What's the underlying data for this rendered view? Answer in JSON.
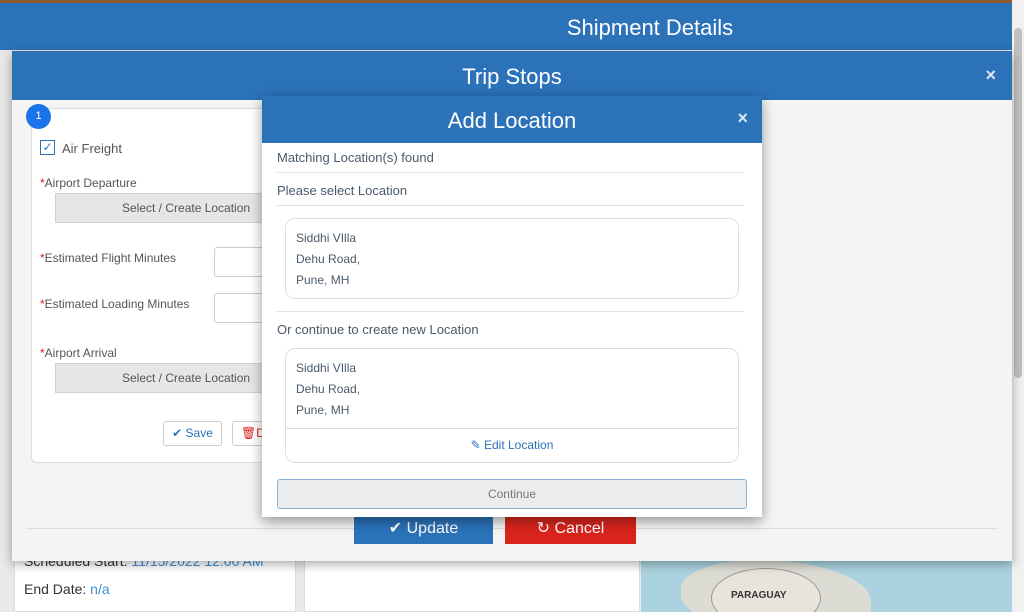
{
  "page": {
    "title": "Shipment Details",
    "scheduled_start_label": "Scheduled Start:",
    "scheduled_start_value": "11/15/2022 12:00 AM",
    "end_date_label": "End Date:",
    "end_date_value": "n/a",
    "map_label": "PARAGUAY"
  },
  "trip_modal": {
    "title": "Trip Stops",
    "close_glyph": "×",
    "stop_number": "1",
    "air_freight_label": "Air Freight",
    "air_freight_checked": true,
    "airport_departure_label": "Airport Departure",
    "departure_button": "Select / Create Location",
    "flight_minutes_label": "Estimated Flight Minutes",
    "loading_minutes_label": "Estimated Loading Minutes",
    "airport_arrival_label": "Airport Arrival",
    "arrival_button": "Select / Create Location",
    "save_label": "Save",
    "delete_label": "D",
    "update_label": "Update",
    "cancel_label": "Cancel"
  },
  "add_location_modal": {
    "title": "Add Location",
    "close_glyph": "×",
    "matching_text": "Matching Location(s) found",
    "select_text": "Please select Location",
    "matched_location": [
      "Siddhi VIlla",
      "Dehu Road,",
      "Pune, MH"
    ],
    "or_continue_text": "Or continue to create new Location",
    "new_location": [
      "Siddhi VIlla",
      "Dehu Road,",
      "Pune, MH"
    ],
    "edit_location_label": "Edit Location",
    "continue_label": "Continue"
  },
  "icons": {
    "close": "close-icon",
    "check": "check-icon",
    "save": "check-icon",
    "delete": "trash-icon",
    "cancel": "refresh-icon",
    "edit": "edit-icon"
  },
  "colors": {
    "header_blue": "#2b72b9",
    "cancel_red": "#d9241c",
    "required_red": "#d9241c"
  }
}
